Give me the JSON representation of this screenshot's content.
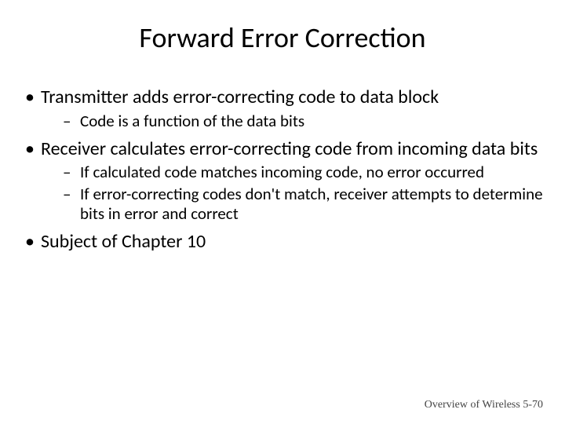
{
  "title": "Forward Error Correction",
  "bullets": {
    "b1": "Transmitter adds error-correcting code to data block",
    "b1_1": "Code is a function of the data bits",
    "b2": "Receiver calculates error-correcting code from incoming data bits",
    "b2_1": "If calculated code matches incoming code, no error occurred",
    "b2_2": "If error-correcting codes don't match, receiver attempts to determine bits in error and correct",
    "b3": "Subject of Chapter 10"
  },
  "footer": "Overview of Wireless 5-70"
}
